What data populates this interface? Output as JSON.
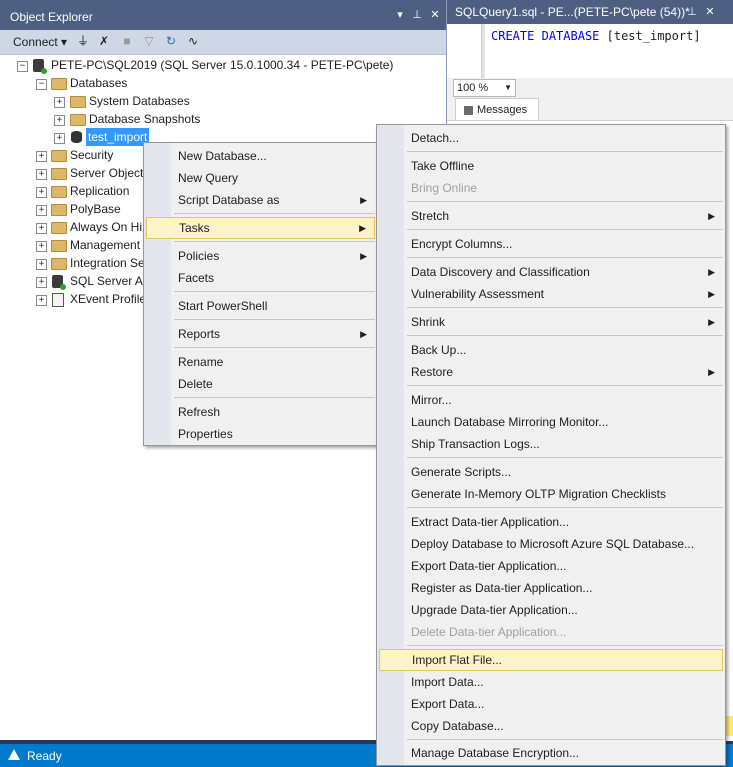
{
  "object_explorer": {
    "title": "Object Explorer",
    "pin_icon": "pin-icon",
    "close_icon": "close-icon",
    "toolbar": {
      "connect_label": "Connect"
    },
    "tree": {
      "server": "PETE-PC\\SQL2019 (SQL Server 15.0.1000.34 - PETE-PC\\pete)",
      "databases": "Databases",
      "system_databases": "System Databases",
      "database_snapshots": "Database Snapshots",
      "test_import": "test_import",
      "security": "Security",
      "server_objects": "Server Objects",
      "replication": "Replication",
      "polybase": "PolyBase",
      "always_on": "Always On Hi",
      "management": "Management",
      "integration": "Integration Se",
      "agent": "SQL Server Ag",
      "xevent": "XEvent Profile"
    }
  },
  "query_editor": {
    "tab_title": "SQLQuery1.sql - PE...(PETE-PC\\pete (54))*",
    "code_kw1": "CREATE",
    "code_kw2": "DATABASE",
    "code_rest": "[test_import]",
    "zoom": "100 %",
    "messages_tab": "Messages"
  },
  "status": {
    "text": "Ready"
  },
  "context_menu": {
    "new_database": "New Database...",
    "new_query": "New Query",
    "script_database_as": "Script Database as",
    "tasks": "Tasks",
    "policies": "Policies",
    "facets": "Facets",
    "start_powershell": "Start PowerShell",
    "reports": "Reports",
    "rename": "Rename",
    "delete": "Delete",
    "refresh": "Refresh",
    "properties": "Properties"
  },
  "tasks_menu": {
    "detach": "Detach...",
    "take_offline": "Take Offline",
    "bring_online": "Bring Online",
    "stretch": "Stretch",
    "encrypt_columns": "Encrypt Columns...",
    "data_discovery": "Data Discovery and Classification",
    "vulnerability": "Vulnerability Assessment",
    "shrink": "Shrink",
    "back_up": "Back Up...",
    "restore": "Restore",
    "mirror": "Mirror...",
    "launch_mirroring": "Launch Database Mirroring Monitor...",
    "ship_logs": "Ship Transaction Logs...",
    "generate_scripts": "Generate Scripts...",
    "generate_oltp": "Generate In-Memory OLTP Migration Checklists",
    "extract_dac": "Extract Data-tier Application...",
    "deploy_azure": "Deploy Database to Microsoft Azure SQL Database...",
    "export_dac": "Export Data-tier Application...",
    "register_dac": "Register as Data-tier Application...",
    "upgrade_dac": "Upgrade Data-tier Application...",
    "delete_dac": "Delete Data-tier Application...",
    "import_flat_file": "Import Flat File...",
    "import_data": "Import Data...",
    "export_data": "Export Data...",
    "copy_database": "Copy Database...",
    "manage_encryption": "Manage Database Encryption..."
  },
  "colors": {
    "title_bar": "#4d6082",
    "status_bar": "#007acc",
    "selection": "#3399ff",
    "menu_highlight": "#fcf3c6"
  }
}
